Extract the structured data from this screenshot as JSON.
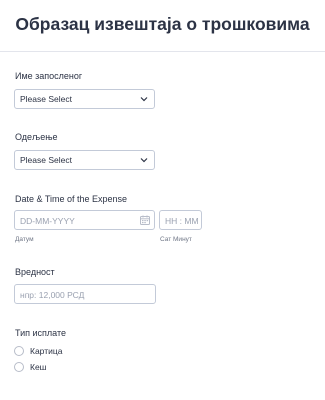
{
  "form": {
    "title": "Образац извештаја о трошковима"
  },
  "fields": {
    "employee": {
      "label": "Име запосленог",
      "value": "Please Select"
    },
    "department": {
      "label": "Одељење",
      "value": "Please Select"
    },
    "datetime": {
      "label": "Date & Time of the Expense",
      "date_placeholder": "DD-MM-YYYY",
      "date_sublabel": "Датум",
      "time_placeholder": "HH : MM",
      "time_sublabel": "Сат Минут"
    },
    "amount": {
      "label": "Вредност",
      "placeholder": "нпр: 12,000 РСД"
    },
    "payment_type": {
      "label": "Тип исплате",
      "options": [
        "Картица",
        "Кеш"
      ]
    }
  },
  "colors": {
    "text": "#2c3345",
    "border": "#c3cad8",
    "placeholder": "#9aa1b0"
  }
}
